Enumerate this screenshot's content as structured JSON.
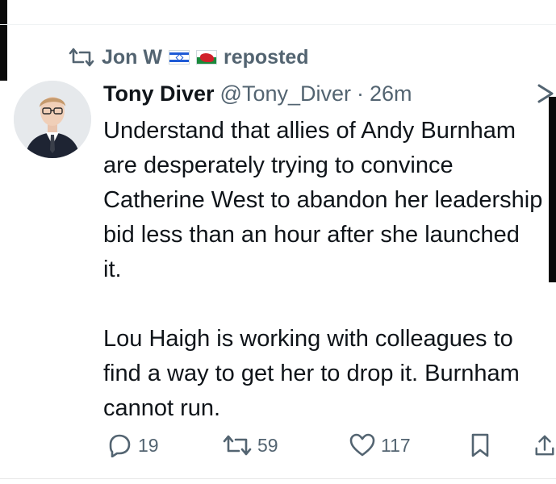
{
  "repost_bar": {
    "user": "Jon W",
    "flags": [
      "israel-flag",
      "wales-flag"
    ],
    "label": "reposted"
  },
  "tweet": {
    "author_name": "Tony Diver",
    "handle": "@Tony_Diver",
    "separator": "·",
    "time": "26m",
    "paragraphs": [
      "Understand that allies of Andy Burnham are desperately trying to convince Catherine West to abandon her leadership bid less than an hour after she launched it.",
      "Lou Haigh is working with colleagues to find a way to get her to drop it. Burnham cannot run."
    ]
  },
  "actions": {
    "replies": "19",
    "reposts": "59",
    "likes": "117"
  },
  "colors": {
    "text": "#0f1419",
    "secondary": "#536471",
    "background": "#ffffff"
  }
}
